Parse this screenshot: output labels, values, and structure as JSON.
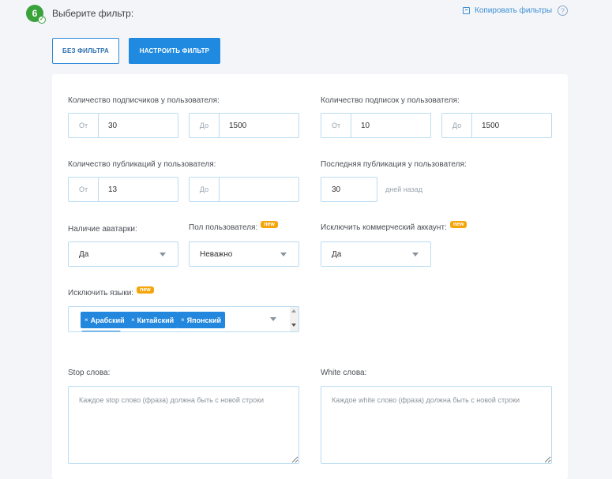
{
  "step": {
    "number": "6",
    "title": "Выберите фильтр:"
  },
  "header": {
    "copy_label": "Копировать фильтры",
    "help_symbol": "?"
  },
  "buttons": {
    "no_filter": "БЕЗ ФИЛЬТРА",
    "configure": "НАСТРОИТЬ ФИЛЬТР"
  },
  "badge_new": "new",
  "filters": {
    "followers": {
      "label": "Количество подписчиков у пользователя:",
      "from_prefix": "От",
      "from_value": "30",
      "to_prefix": "До",
      "to_value": "1500"
    },
    "following": {
      "label": "Количество подписок у пользователя:",
      "from_prefix": "От",
      "from_value": "10",
      "to_prefix": "До",
      "to_value": "1500"
    },
    "posts": {
      "label": "Количество публикаций у пользователя:",
      "from_prefix": "От",
      "from_value": "13",
      "to_prefix": "До",
      "to_value": ""
    },
    "last_post": {
      "label": "Последняя публикация у пользователя:",
      "value": "30",
      "suffix": "дней назад"
    },
    "avatar": {
      "label": "Наличие аватарки:",
      "value": "Да"
    },
    "gender": {
      "label": "Пол пользователя:",
      "value": "Неважно"
    },
    "exclude_commercial": {
      "label": "Исключить коммерческий аккаунт:",
      "value": "Да"
    },
    "exclude_languages": {
      "label": "Исключить языки:",
      "tags": [
        "Арабский",
        "Китайский",
        "Японский"
      ],
      "remove_symbol": "×"
    },
    "stop_words": {
      "label": "Stop слова:",
      "placeholder": "Каждое stop слово (фраза) должна быть с новой строки"
    },
    "white_words": {
      "label": "White слова:",
      "placeholder": "Каждое white слово (фраза) должна быть с новой строки"
    }
  },
  "colors": {
    "primary": "#1f8ae0",
    "step_green": "#3aa23a",
    "badge_orange": "#f5a50b",
    "input_border": "#b9dcf3"
  }
}
